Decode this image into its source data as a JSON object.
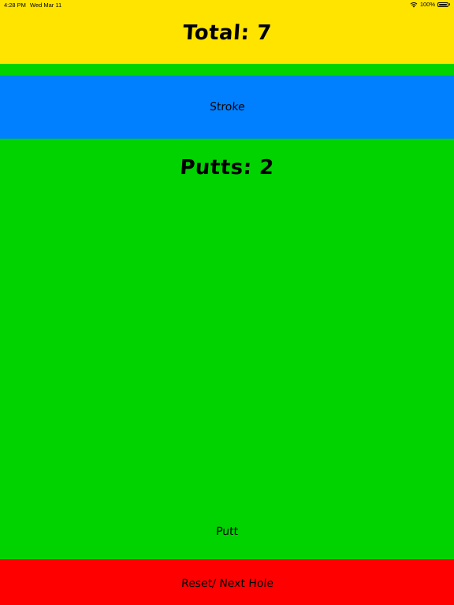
{
  "status_bar": {
    "time": "4:28 PM",
    "date": "Wed Mar 11",
    "battery_percent": "100%",
    "battery_level": 1.0,
    "wifi_icon": "wifi-icon",
    "battery_icon": "battery-icon"
  },
  "total": {
    "label": "Total: 7"
  },
  "stroke_button": {
    "label": "Stroke"
  },
  "putts": {
    "label": "Putts: 2"
  },
  "putt_button": {
    "label": "Putt"
  },
  "reset_button": {
    "label": "Reset/ Next Hole"
  },
  "colors": {
    "total_bar": "#ffe400",
    "stroke_button": "#0080ff",
    "background": "#00d300",
    "reset_button": "#ff0000"
  }
}
